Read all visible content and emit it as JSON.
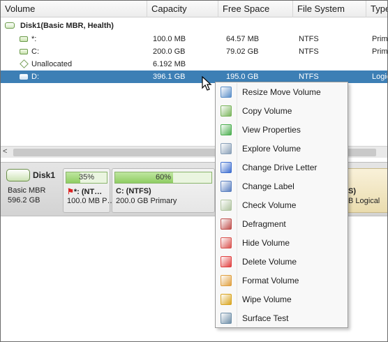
{
  "table": {
    "columns": [
      "Volume",
      "Capacity",
      "Free Space",
      "File System",
      "Type"
    ],
    "disk_row": {
      "label": "Disk1(Basic MBR, Health)"
    },
    "rows": [
      {
        "volume": "*:",
        "capacity": "100.0 MB",
        "free": "64.57 MB",
        "fs": "NTFS",
        "type": "Primary",
        "icon": "drive-icon"
      },
      {
        "volume": "C:",
        "capacity": "200.0 GB",
        "free": "79.02 GB",
        "fs": "NTFS",
        "type": "Primary",
        "icon": "drive-icon"
      },
      {
        "volume": "Unallocated",
        "capacity": "6.192 MB",
        "free": "",
        "fs": "",
        "type": "",
        "icon": "unallocated-icon"
      },
      {
        "volume": "D:",
        "capacity": "396.1 GB",
        "free": "195.0 GB",
        "fs": "NTFS",
        "type": "Logical",
        "icon": "drive-icon",
        "selected": true
      }
    ]
  },
  "scrollbar": {
    "left_arrow": "<"
  },
  "diskmap": {
    "disk": {
      "name": "Disk1",
      "type": "Basic MBR",
      "size": "596.2 GB"
    },
    "partitions": [
      {
        "used_percent": 35,
        "percent_label": "35%",
        "title": "*: (NT…",
        "sub": "100.0 MB P…",
        "flag": true
      },
      {
        "used_percent": 60,
        "percent_label": "60%",
        "title": "C: (NTFS)",
        "sub": "200.0 GB Primary"
      },
      {
        "title": "S)",
        "sub": "B Logical",
        "logical": true
      }
    ]
  },
  "context_menu": {
    "items": [
      {
        "label": "Resize Move Volume",
        "icon": "resize-move-icon",
        "color": "#5b8fc9"
      },
      {
        "label": "Copy Volume",
        "icon": "copy-volume-icon",
        "color": "#7ab55c"
      },
      {
        "label": "View Properties",
        "icon": "view-properties-icon",
        "color": "#4caf50"
      },
      {
        "label": "Explore Volume",
        "icon": "explore-volume-icon",
        "color": "#8aa0b8"
      },
      {
        "label": "Change Drive Letter",
        "icon": "change-drive-letter-icon",
        "color": "#3f6fd0"
      },
      {
        "label": "Change Label",
        "icon": "change-label-icon",
        "color": "#5a7fc0"
      },
      {
        "label": "Check Volume",
        "icon": "check-volume-icon",
        "color": "#b0c4a0"
      },
      {
        "label": "Defragment",
        "icon": "defragment-icon",
        "color": "#c0504d"
      },
      {
        "label": "Hide Volume",
        "icon": "hide-volume-icon",
        "color": "#d9534f"
      },
      {
        "label": "Delete Volume",
        "icon": "delete-volume-icon",
        "color": "#e04040"
      },
      {
        "label": "Format Volume",
        "icon": "format-volume-icon",
        "color": "#e0a040"
      },
      {
        "label": "Wipe Volume",
        "icon": "wipe-volume-icon",
        "color": "#d9a521"
      },
      {
        "label": "Surface Test",
        "icon": "surface-test-icon",
        "color": "#6f8fa8"
      }
    ]
  },
  "colors": {
    "selection": "#3d7fb5",
    "bar_fill": "#8fcd63",
    "logical_partition": "#eadcae"
  }
}
